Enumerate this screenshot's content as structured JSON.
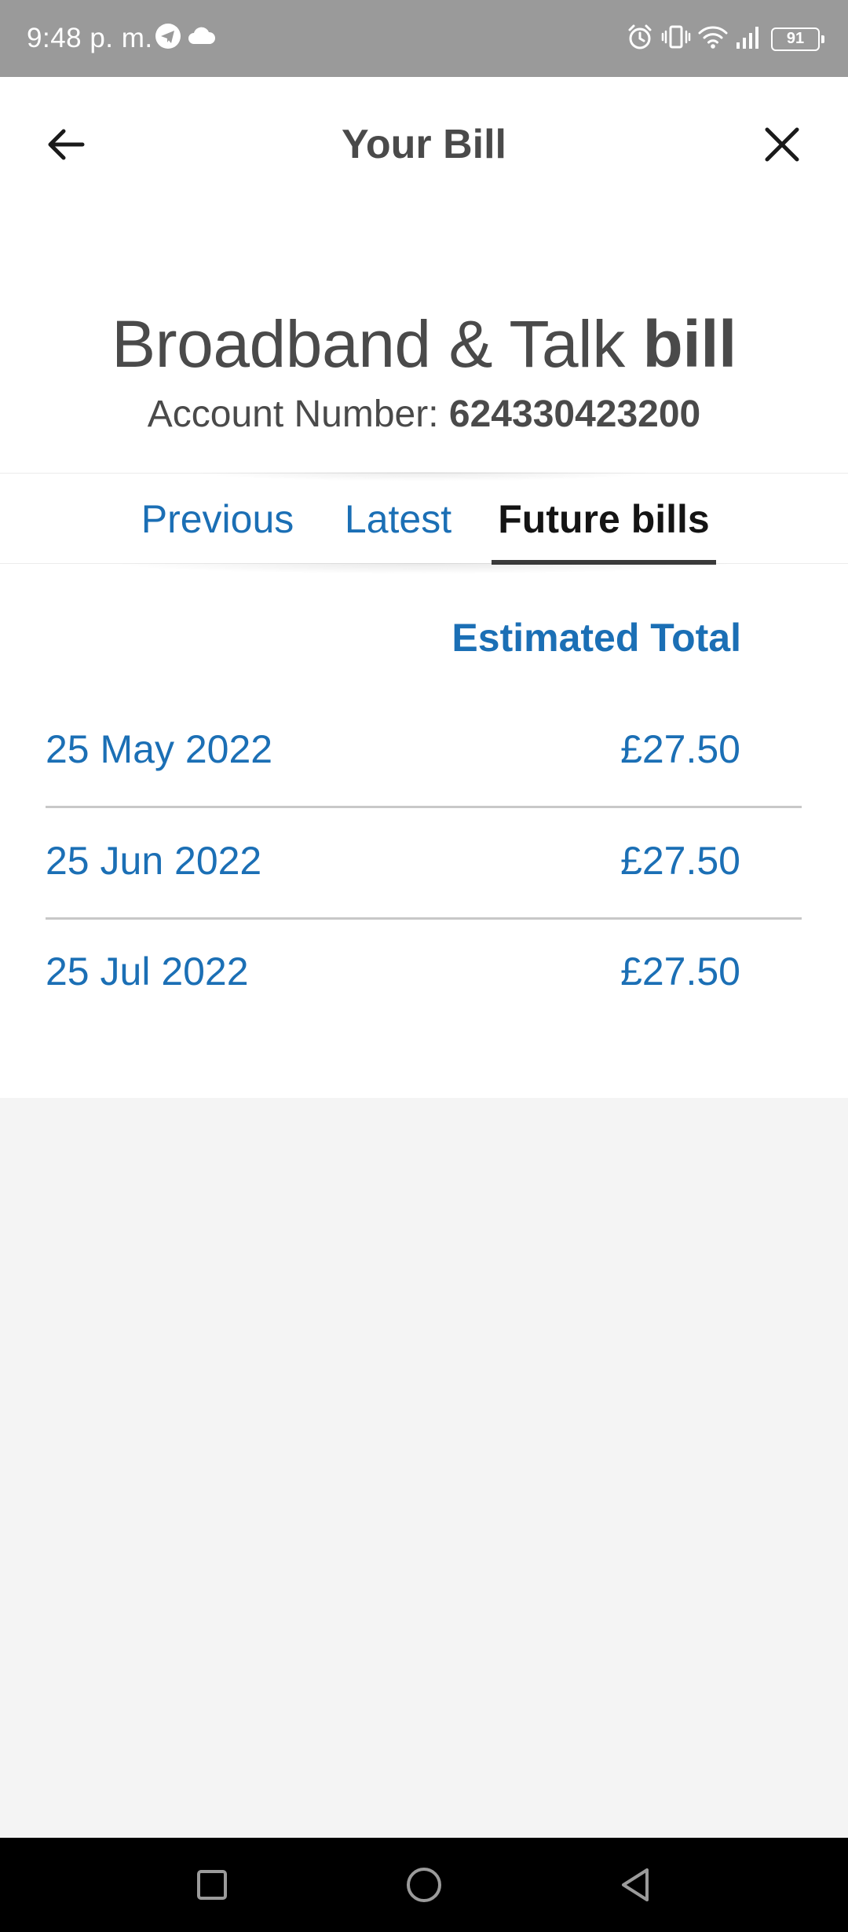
{
  "status_bar": {
    "time": "9:48 p. m.",
    "battery_level": "91",
    "left_icons": [
      "telegram-icon",
      "cloud-icon"
    ],
    "right_icons": [
      "alarm-icon",
      "vibrate-icon",
      "wifi-icon",
      "signal-icon",
      "battery-icon"
    ]
  },
  "header": {
    "title": "Your Bill",
    "back_icon": "arrow-left-icon",
    "close_icon": "close-icon"
  },
  "bill": {
    "title_main": "Broadband & Talk ",
    "title_bold": "bill",
    "account_label": "Account Number: ",
    "account_number": "624330423200"
  },
  "tabs": [
    {
      "label": "Previous",
      "selected": false
    },
    {
      "label": "Latest",
      "selected": false
    },
    {
      "label": "Future bills",
      "selected": true
    }
  ],
  "future_bills": {
    "column_header": "Estimated Total",
    "rows": [
      {
        "date": "25 May 2022",
        "amount": "£27.50"
      },
      {
        "date": "25 Jun 2022",
        "amount": "£27.50"
      },
      {
        "date": "25 Jul 2022",
        "amount": "£27.50"
      }
    ]
  },
  "colors": {
    "accent": "#1b6fb5",
    "text_dark": "#4a4a4a",
    "status_bar": "#9a9a9a",
    "page_background": "#f4f4f4"
  },
  "nav_bar": {
    "icons": [
      "recent-apps-icon",
      "home-icon",
      "back-icon"
    ]
  }
}
